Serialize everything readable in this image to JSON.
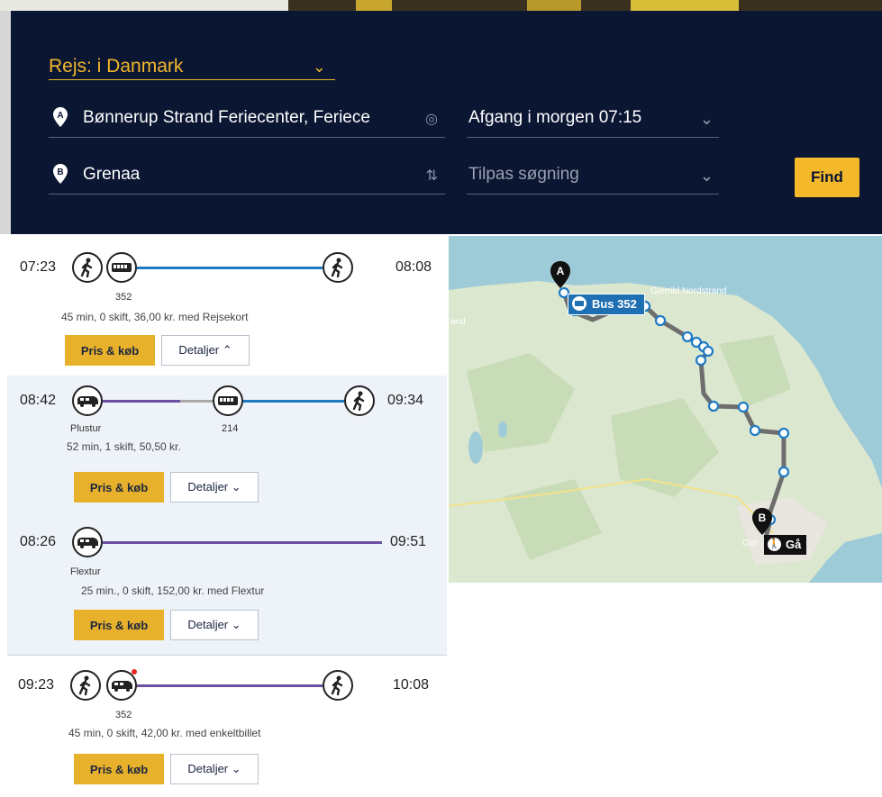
{
  "search": {
    "trip_type": "Rejs: i Danmark",
    "from": "Bønnerup Strand Feriecenter, Feriece",
    "to": "Grenaa",
    "departure": "Afgang i morgen 07:15",
    "adjust": "Tilpas søgning",
    "find_label": "Find",
    "from_marker": "A",
    "to_marker": "B"
  },
  "results": [
    {
      "dep": "07:23",
      "arr": "08:08",
      "legs": [
        "walk",
        "bus",
        "walk"
      ],
      "line_labels": [
        "352"
      ],
      "summary": "45 min, 0 skift, 36,00 kr. med Rejsekort",
      "buy": "Pris & køb",
      "details": "Detaljer ⌃"
    },
    {
      "dep": "08:42",
      "arr": "09:34",
      "legs": [
        "taxi",
        "bus",
        "walk"
      ],
      "line_labels": [
        "Plustur",
        "214"
      ],
      "summary": "52 min, 1 skift, 50,50 kr.",
      "buy": "Pris & køb",
      "details": "Detaljer ⌄"
    },
    {
      "dep": "08:26",
      "arr": "09:51",
      "legs": [
        "taxi"
      ],
      "line_labels": [
        "Flextur"
      ],
      "summary": "25 min., 0 skift, 152,00 kr. med Flextur",
      "buy": "Pris & køb",
      "details": "Detaljer ⌄"
    },
    {
      "dep": "09:23",
      "arr": "10:08",
      "legs": [
        "walk",
        "taxi",
        "walk"
      ],
      "line_labels": [
        "352"
      ],
      "summary": "45 min, 0 skift, 42,00 kr. med enkeltbillet",
      "buy": "Pris & køb",
      "details": "Detaljer ⌄"
    }
  ],
  "map": {
    "bus_label": "Bus 352",
    "walk_label": "Gå",
    "marker_a": "A",
    "marker_b": "B",
    "place_1": "Gjerrild Nordstrand",
    "place_2": "and",
    "place_3": "Gre"
  },
  "colors": {
    "panel_bg": "#0b1633",
    "accent": "#f2b72b",
    "bus_line": "#1f7ac4",
    "flex_line": "#6b4fa0",
    "map_route": "#6e6e6e"
  }
}
